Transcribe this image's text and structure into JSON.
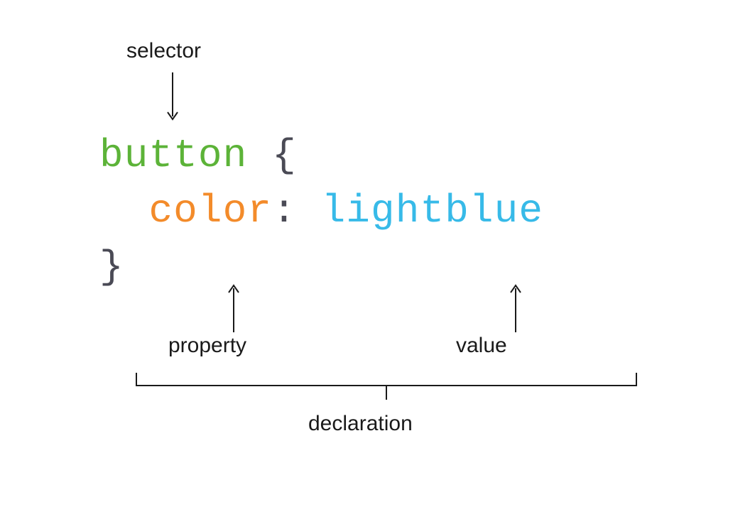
{
  "code": {
    "selector": "button",
    "open_brace": "{",
    "property": "color",
    "colon": ":",
    "value": "lightblue",
    "close_brace": "}"
  },
  "labels": {
    "selector": "selector",
    "property": "property",
    "value": "value",
    "declaration": "declaration"
  },
  "colors": {
    "selector": "#5cb338",
    "property": "#f38b2a",
    "value": "#37bae8",
    "brace": "#4a4a55",
    "label": "#1a1a1a"
  }
}
